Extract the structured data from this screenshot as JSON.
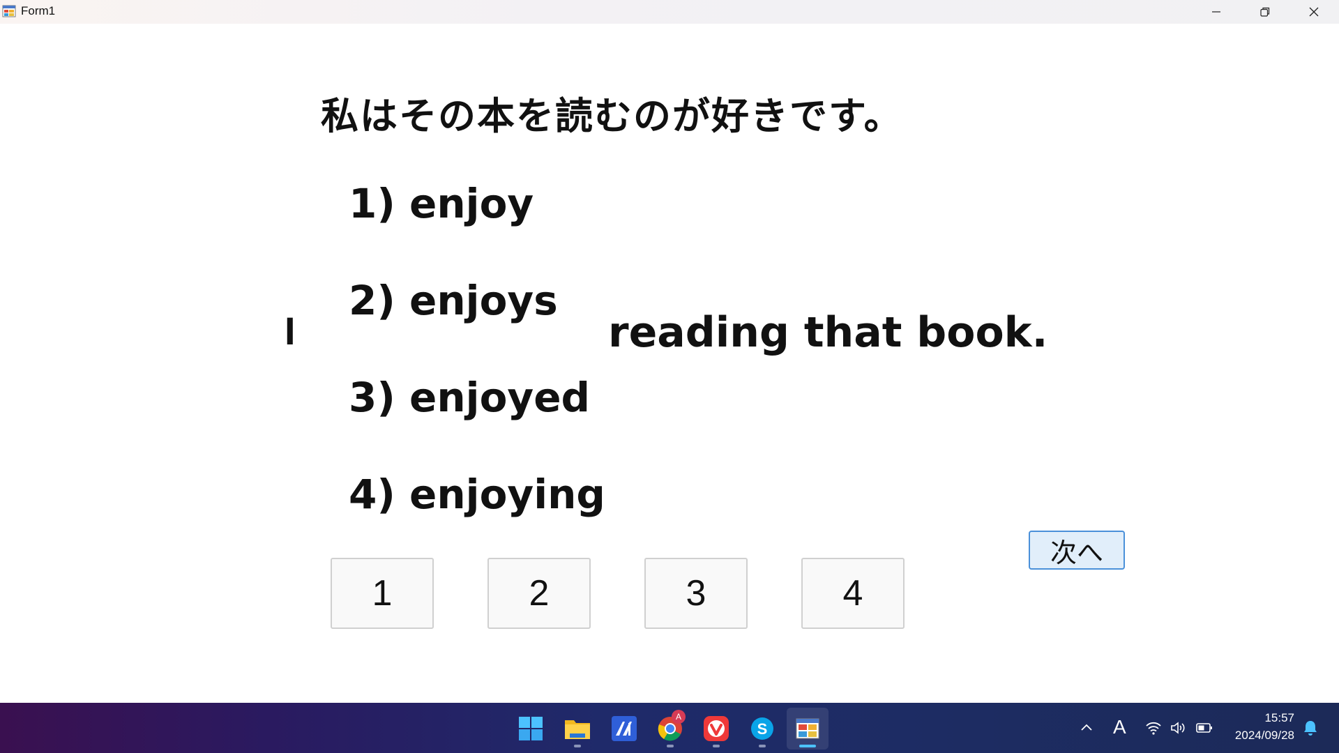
{
  "window": {
    "title": "Form1"
  },
  "question": {
    "japanese": "私はその本を読むのが好きです。",
    "subject": "I",
    "sentence_rest": "reading that book."
  },
  "choices": [
    "1) enjoy",
    "2) enjoys",
    "3) enjoyed",
    "4) enjoying"
  ],
  "answer_buttons": [
    "1",
    "2",
    "3",
    "4"
  ],
  "next_button": "次へ",
  "taskbar": {
    "apps": [
      "start-icon",
      "file-explorer-icon",
      "app-icon",
      "chrome-icon",
      "vivaldi-icon",
      "skype-icon",
      "form-app-icon"
    ],
    "chrome_badge": "A",
    "ime_indicator": "A",
    "time": "15:57",
    "date": "2024/09/28"
  },
  "colors": {
    "next_button_border": "#4a90d9",
    "next_button_bg": "#e1eefa",
    "taskbar_start": "#3a1050",
    "taskbar_end": "#1c2a58",
    "active_indicator": "#4cc2ff"
  }
}
